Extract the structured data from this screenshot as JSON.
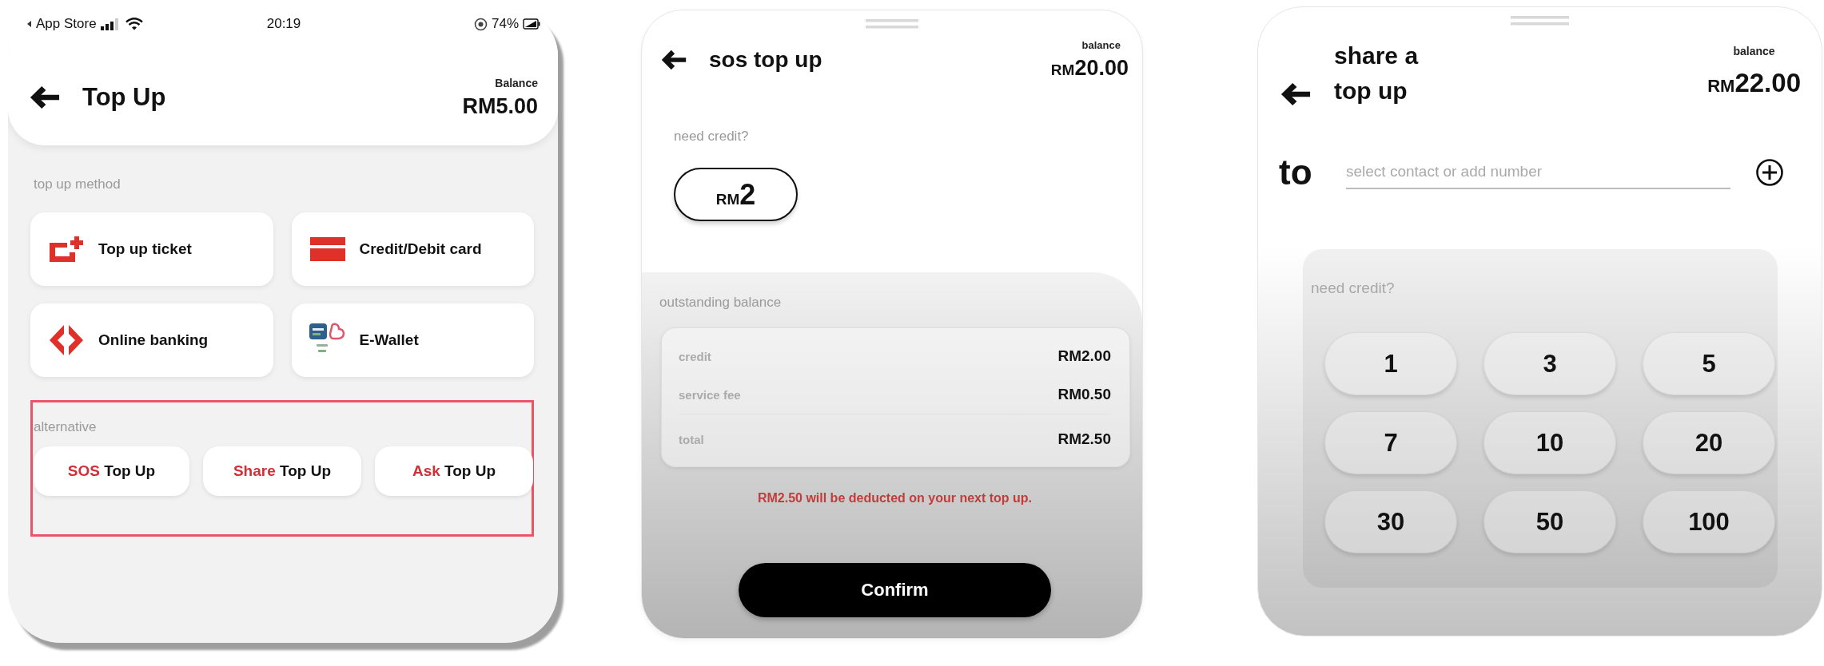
{
  "top_up_screen": {
    "status_bar": {
      "back_label": "App Store",
      "time": "20:19",
      "battery": "74%"
    },
    "header": {
      "title": "Top Up",
      "balance_label": "Balance",
      "balance": "RM5.00"
    },
    "methods": {
      "label": "top up method",
      "items": [
        {
          "kind": "ticket",
          "label": "Top up ticket"
        },
        {
          "kind": "card",
          "label": "Credit/Debit card"
        },
        {
          "kind": "bank",
          "label": "Online banking"
        },
        {
          "kind": "wallet",
          "label": "E-Wallet"
        }
      ]
    },
    "alternative": {
      "label": "alternative",
      "highlighted": true,
      "options": [
        {
          "accent": "SOS",
          "label": "Top Up"
        },
        {
          "accent": "Share",
          "label": "Top Up"
        },
        {
          "accent": "Ask",
          "label": "Top Up"
        }
      ]
    }
  },
  "sos_top_up_screen": {
    "header": {
      "title": "sos top up",
      "balance_label": "balance",
      "currency": "RM",
      "balance": "20.00"
    },
    "credit": {
      "label": "need credit?",
      "options": [
        {
          "currency": "RM",
          "amount": "2",
          "selected": true
        }
      ]
    },
    "outstanding": {
      "label": "outstanding balance",
      "rows": [
        {
          "kind": "item",
          "label": "credit",
          "value": "RM2.00"
        },
        {
          "kind": "item",
          "label": "service fee",
          "value": "RM0.50"
        },
        {
          "kind": "total",
          "label": "total",
          "value": "RM2.50"
        }
      ]
    },
    "note": "RM2.50 will be deducted on your next top up.",
    "confirm_button": "Confirm"
  },
  "share_top_up_screen": {
    "header": {
      "title": "share a top up",
      "balance_label": "balance",
      "currency": "RM",
      "balance": "22.00"
    },
    "recipient": {
      "label": "to",
      "placeholder": "select contact or add number"
    },
    "credit": {
      "label": "need credit?",
      "options": [
        {
          "amount": "1",
          "selected": false
        },
        {
          "amount": "3",
          "selected": false
        },
        {
          "amount": "5",
          "selected": false
        },
        {
          "amount": "7",
          "selected": false
        },
        {
          "amount": "10",
          "selected": false
        },
        {
          "amount": "20",
          "selected": false
        },
        {
          "amount": "30",
          "selected": false
        },
        {
          "amount": "50",
          "selected": false
        },
        {
          "amount": "100",
          "selected": false
        }
      ]
    }
  }
}
